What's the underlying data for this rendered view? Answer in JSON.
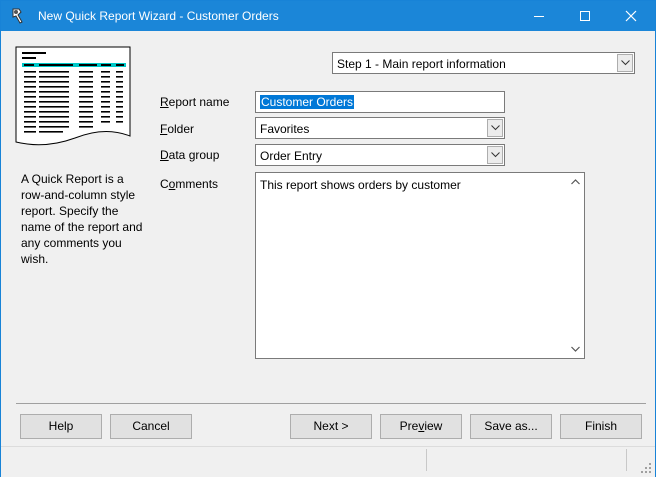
{
  "window": {
    "title": "New Quick Report Wizard - Customer Orders",
    "minimize_icon": "minimize-icon",
    "maximize_icon": "maximize-icon",
    "close_icon": "close-icon"
  },
  "step": {
    "selected": "Step 1 - Main report information"
  },
  "description": "A Quick Report is a row-and-column style report. Specify the name of the report and any comments you wish.",
  "form": {
    "report_name": {
      "label_u": "R",
      "label_rest": "eport name",
      "value": "Customer Orders"
    },
    "folder": {
      "label_u": "F",
      "label_rest": "older",
      "value": "Favorites"
    },
    "data_group": {
      "label_u": "D",
      "label_rest": "ata group",
      "value": "Order Entry"
    },
    "comments": {
      "label_pre": "C",
      "label_u": "o",
      "label_rest": "mments",
      "value": "This report shows orders by customer"
    }
  },
  "buttons": {
    "help": "Help",
    "cancel": "Cancel",
    "next": "Next >",
    "preview_pre": "Pre",
    "preview_u": "v",
    "preview_rest": "iew",
    "save_as": "Save as...",
    "finish": "Finish"
  },
  "colors": {
    "titlebar": "#1b86d8",
    "selection": "#0078d7",
    "thumb_header": "#00c8c8"
  }
}
